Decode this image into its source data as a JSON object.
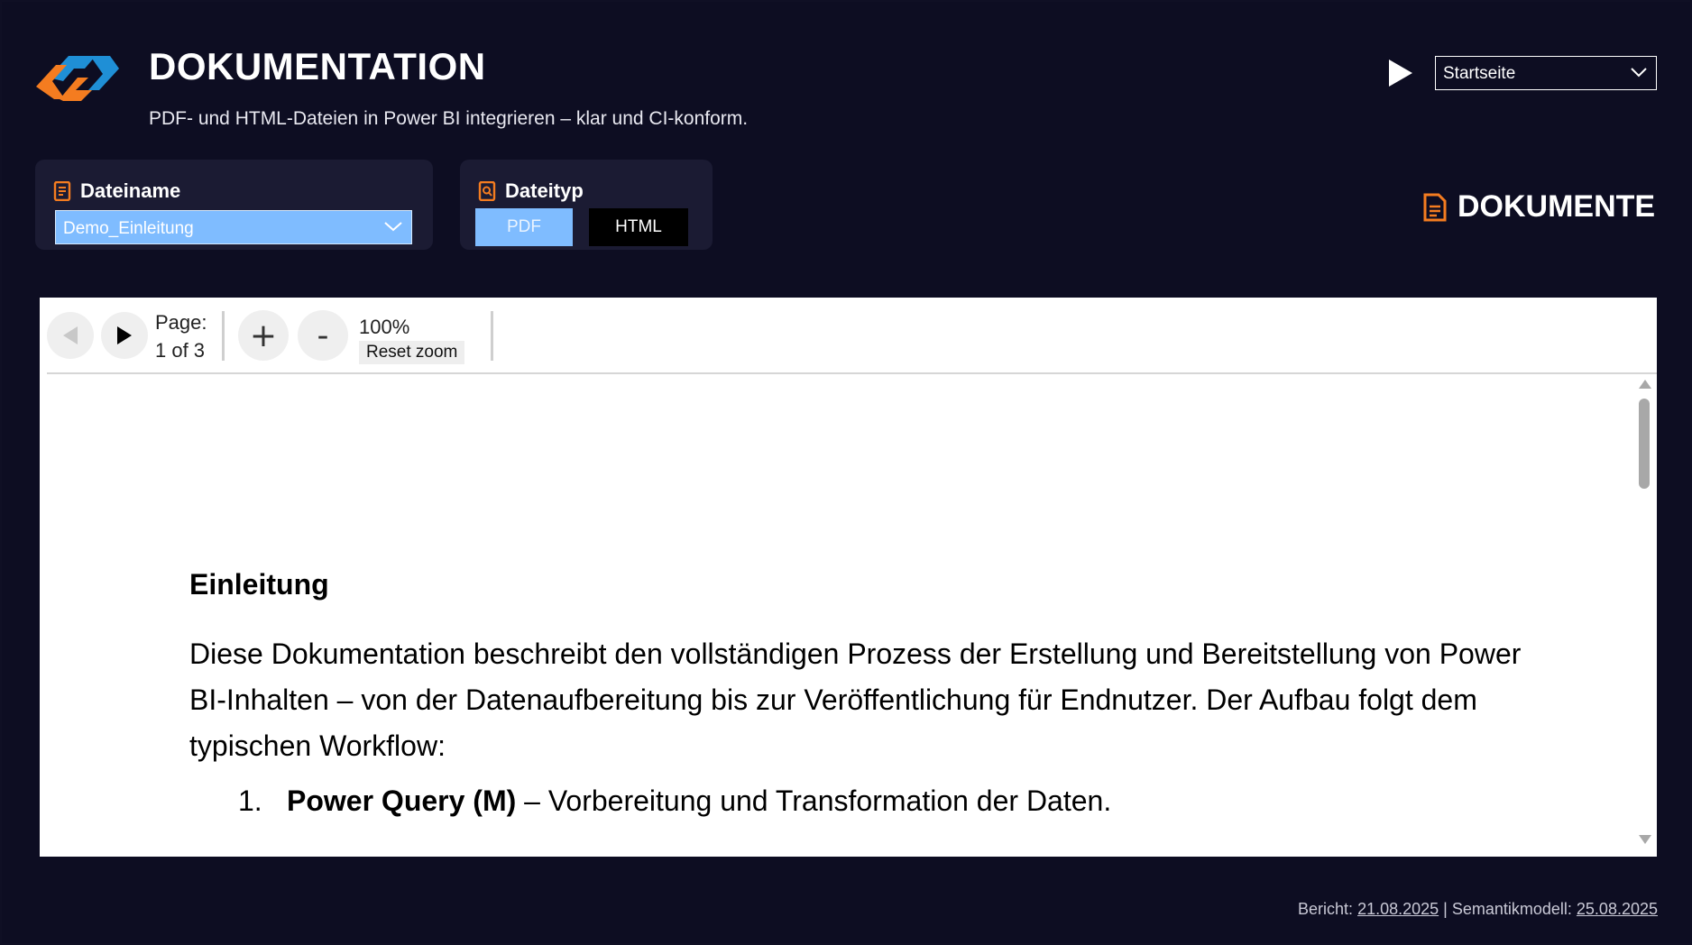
{
  "header": {
    "title": "DOKUMENTATION",
    "subtitle": "PDF- und HTML-Dateien in Power BI integrieren – klar und CI-konform.",
    "page_select_value": "Startseite"
  },
  "filters": {
    "filename_label": "Dateiname",
    "filename_value": "Demo_Einleitung",
    "filetype_label": "Dateityp",
    "filetype_options": [
      "PDF",
      "HTML"
    ],
    "filetype_selected": "PDF"
  },
  "documents_heading": "DOKUMENTE",
  "viewer": {
    "page_label": "Page:",
    "page_indicator": "1 of 3",
    "zoom_in": "+",
    "zoom_out": "-",
    "zoom_level": "100%",
    "reset_zoom": "Reset zoom",
    "heading": "Einleitung",
    "paragraph": "Diese Dokumentation beschreibt den vollständigen Prozess der Erstellung und Bereitstellung von Power BI-Inhalten – von der Datenaufbereitung bis zur Veröffentlichung für Endnutzer. Der Aufbau folgt dem typischen Workflow:",
    "list_number": "1.",
    "list_bold": "Power Query (M)",
    "list_text": " – Vorbereitung und Transformation der Daten."
  },
  "footer": {
    "report_label": "Bericht: ",
    "report_date": "21.08.2025",
    "separator": " | ",
    "model_label": "Semantikmodell: ",
    "model_date": "25.08.2025"
  },
  "colors": {
    "background": "#0d0d22",
    "card": "#1b1b33",
    "accent_blue": "#7fbcff",
    "accent_orange": "#f47c20",
    "logo_blue": "#1f8fd6"
  }
}
